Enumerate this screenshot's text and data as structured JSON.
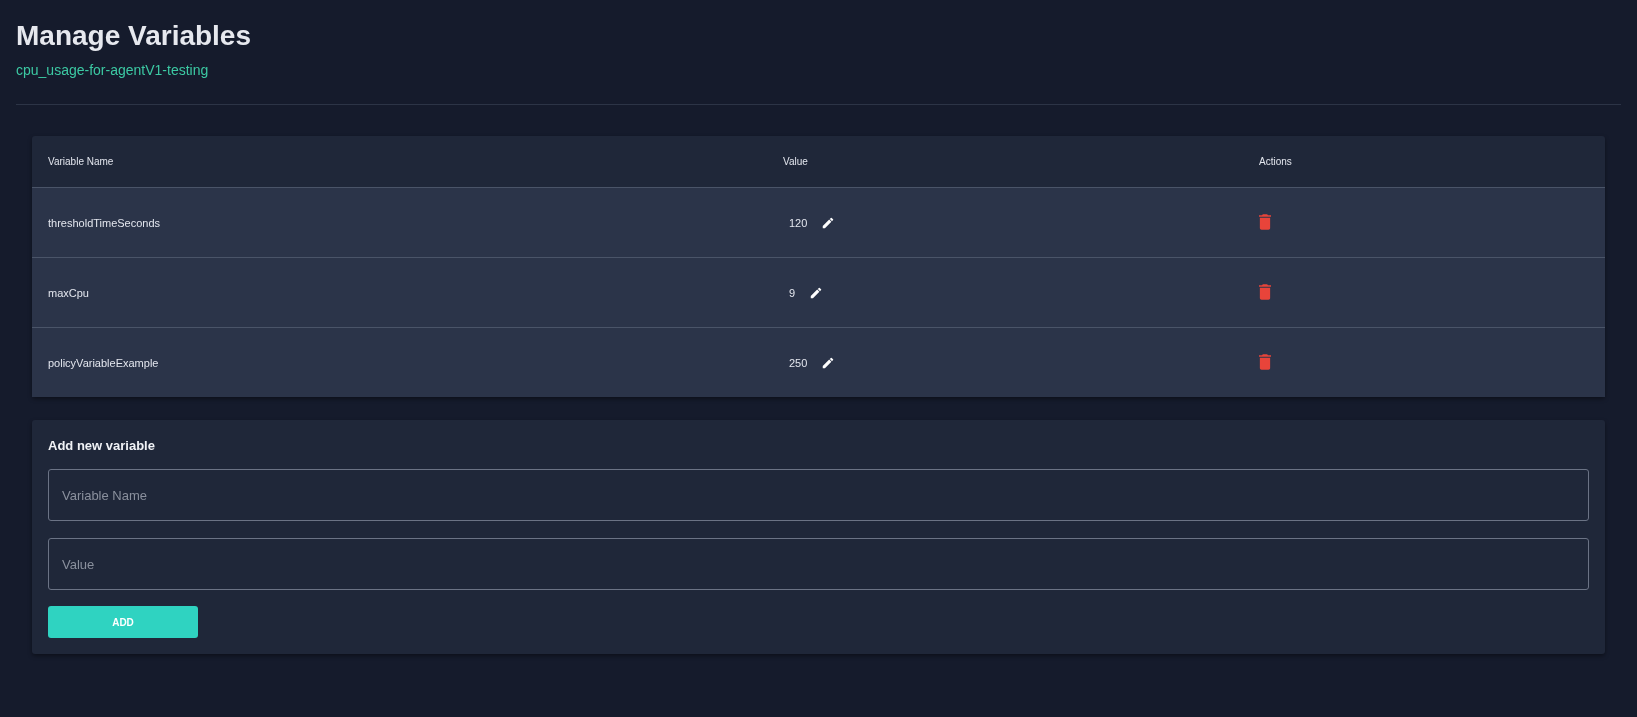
{
  "page": {
    "title": "Manage Variables",
    "subtitle": "cpu_usage-for-agentV1-testing"
  },
  "table": {
    "columns": [
      "Variable Name",
      "Value",
      "Actions"
    ],
    "rows": [
      {
        "name": "thresholdTimeSeconds",
        "value": "120"
      },
      {
        "name": "maxCpu",
        "value": "9"
      },
      {
        "name": "policyVariableExample",
        "value": "250"
      }
    ]
  },
  "form": {
    "title": "Add new variable",
    "fields": [
      {
        "placeholder": "Variable Name"
      },
      {
        "placeholder": "Value"
      }
    ],
    "button": "ADD"
  }
}
